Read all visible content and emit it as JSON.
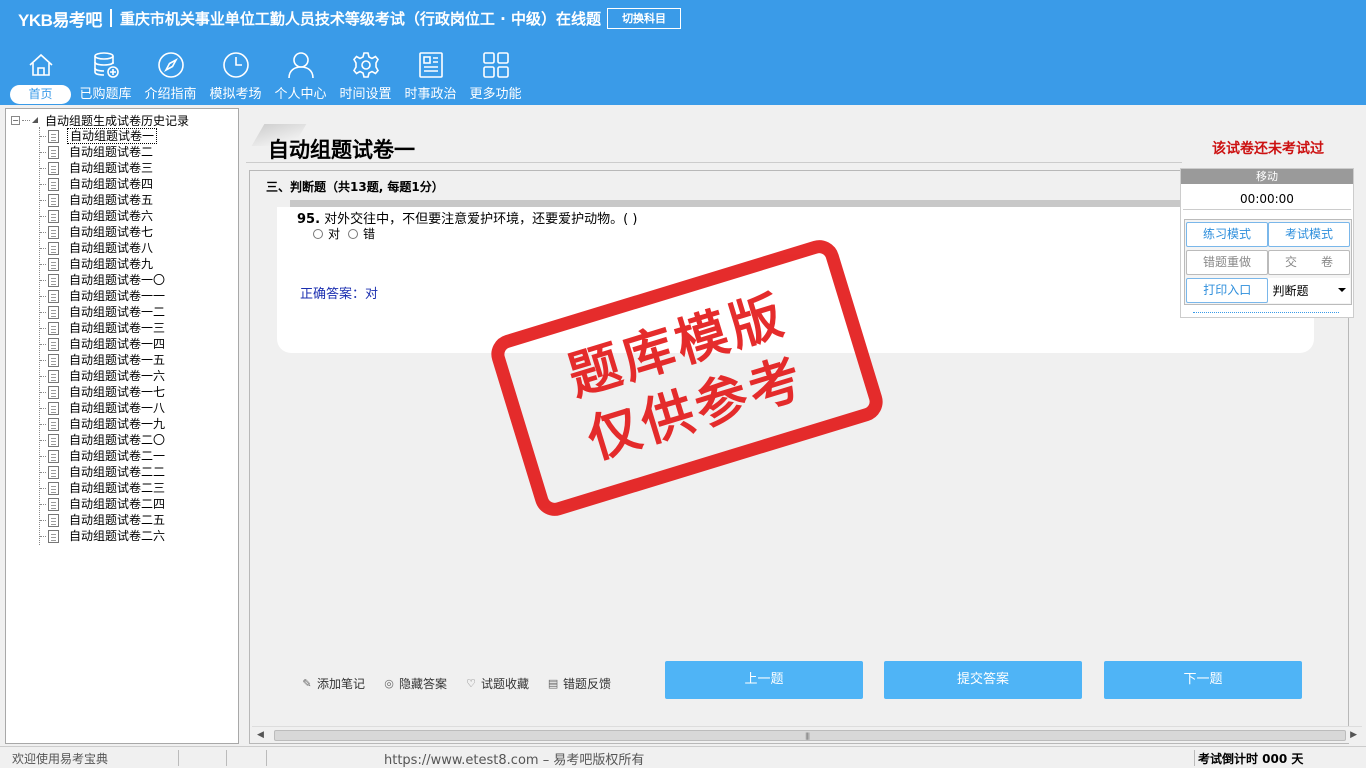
{
  "header": {
    "logo": "YKB易考吧",
    "title": "重庆市机关事业单位工勤人员技术等级考试（行政岗位工 · 中级）在线题",
    "switch_label": "切换科目"
  },
  "nav": [
    {
      "label": "首页",
      "icon": "home-icon",
      "active": true
    },
    {
      "label": "已购题库",
      "icon": "database-icon"
    },
    {
      "label": "介绍指南",
      "icon": "compass-icon"
    },
    {
      "label": "模拟考场",
      "icon": "clock-icon"
    },
    {
      "label": "个人中心",
      "icon": "user-icon"
    },
    {
      "label": "时间设置",
      "icon": "gear-icon"
    },
    {
      "label": "时事政治",
      "icon": "newspaper-icon"
    },
    {
      "label": "更多功能",
      "icon": "grid-icon"
    }
  ],
  "tree": {
    "root_label": "自动组题生成试卷历史记录",
    "items": [
      "自动组题试卷一",
      "自动组题试卷二",
      "自动组题试卷三",
      "自动组题试卷四",
      "自动组题试卷五",
      "自动组题试卷六",
      "自动组题试卷七",
      "自动组题试卷八",
      "自动组题试卷九",
      "自动组题试卷一〇",
      "自动组题试卷一一",
      "自动组题试卷一二",
      "自动组题试卷一三",
      "自动组题试卷一四",
      "自动组题试卷一五",
      "自动组题试卷一六",
      "自动组题试卷一七",
      "自动组题试卷一八",
      "自动组题试卷一九",
      "自动组题试卷二〇",
      "自动组题试卷二一",
      "自动组题试卷二二",
      "自动组题试卷二三",
      "自动组题试卷二四",
      "自动组题试卷二五",
      "自动组题试卷二六"
    ],
    "selected_index": 0
  },
  "exam": {
    "title": "自动组题试卷一",
    "status": "该试卷还未考试过",
    "section": "三、判断题（共13题, 每题1分）",
    "question_number": "95.",
    "question_text": "对外交往中，不但要注意爱护环境，还要爱护动物。( )",
    "options": [
      "对",
      "错"
    ],
    "answer": "正确答案：对"
  },
  "stamp": {
    "line1": "题库模版",
    "line2": "仅供参考",
    "color": "#e41d1d"
  },
  "tool_panel": {
    "header": "移动",
    "timer": "00:00:00",
    "practice_mode": "练习模式",
    "exam_mode": "考试模式",
    "redo_wrong": "错题重做",
    "submit_paper": "交　　卷",
    "print_entry": "打印入口",
    "type_select": "判断题"
  },
  "actions": {
    "add_note": "添加笔记",
    "hide_answer": "隐藏答案",
    "favorite": "试题收藏",
    "feedback": "错题反馈",
    "prev": "上一题",
    "submit": "提交答案",
    "next": "下一题"
  },
  "status_bar": {
    "welcome": "欢迎使用易考宝典",
    "url": "https://www.etest8.com – 易考吧版权所有",
    "countdown": "考试倒计时 000 天"
  },
  "colors": {
    "header_bg": "#3a9be8",
    "button_blue": "#4fb4f6",
    "status_red": "#cc1111",
    "answer_blue": "#1b2fb0"
  }
}
